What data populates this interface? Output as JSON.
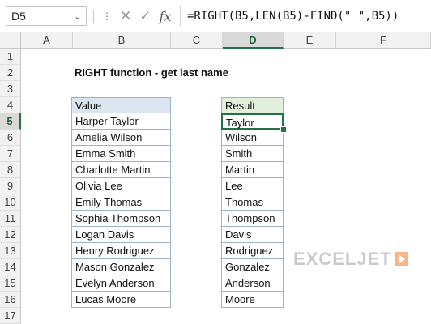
{
  "namebox": {
    "value": "D5"
  },
  "formula_bar": {
    "formula": "=RIGHT(B5,LEN(B5)-FIND(\" \",B5))"
  },
  "columns": [
    "A",
    "B",
    "C",
    "D",
    "E",
    "F"
  ],
  "selected_column": "D",
  "rows": [
    "1",
    "2",
    "3",
    "4",
    "5",
    "6",
    "7",
    "8",
    "9",
    "10",
    "11",
    "12",
    "13",
    "14",
    "15",
    "16",
    "17"
  ],
  "selected_row": "5",
  "title": "RIGHT function - get last name",
  "value_table": {
    "header": "Value",
    "items": [
      "Harper Taylor",
      "Amelia Wilson",
      "Emma Smith",
      "Charlotte Martin",
      "Olivia Lee",
      "Emily Thomas",
      "Sophia Thompson",
      "Logan Davis",
      "Henry Rodriguez",
      "Mason Gonzalez",
      "Evelyn Anderson",
      "Lucas Moore"
    ]
  },
  "result_table": {
    "header": "Result",
    "items": [
      "Taylor",
      "Wilson",
      "Smith",
      "Martin",
      "Lee",
      "Thomas",
      "Thompson",
      "Davis",
      "Rodriguez",
      "Gonzalez",
      "Anderson",
      "Moore"
    ]
  },
  "logo": {
    "text": "EXCELJET"
  },
  "colors": {
    "accent": "#217346",
    "value_header_bg": "#dbe5f1",
    "result_header_bg": "#e2efda",
    "logo_mark": "#f4a460"
  }
}
